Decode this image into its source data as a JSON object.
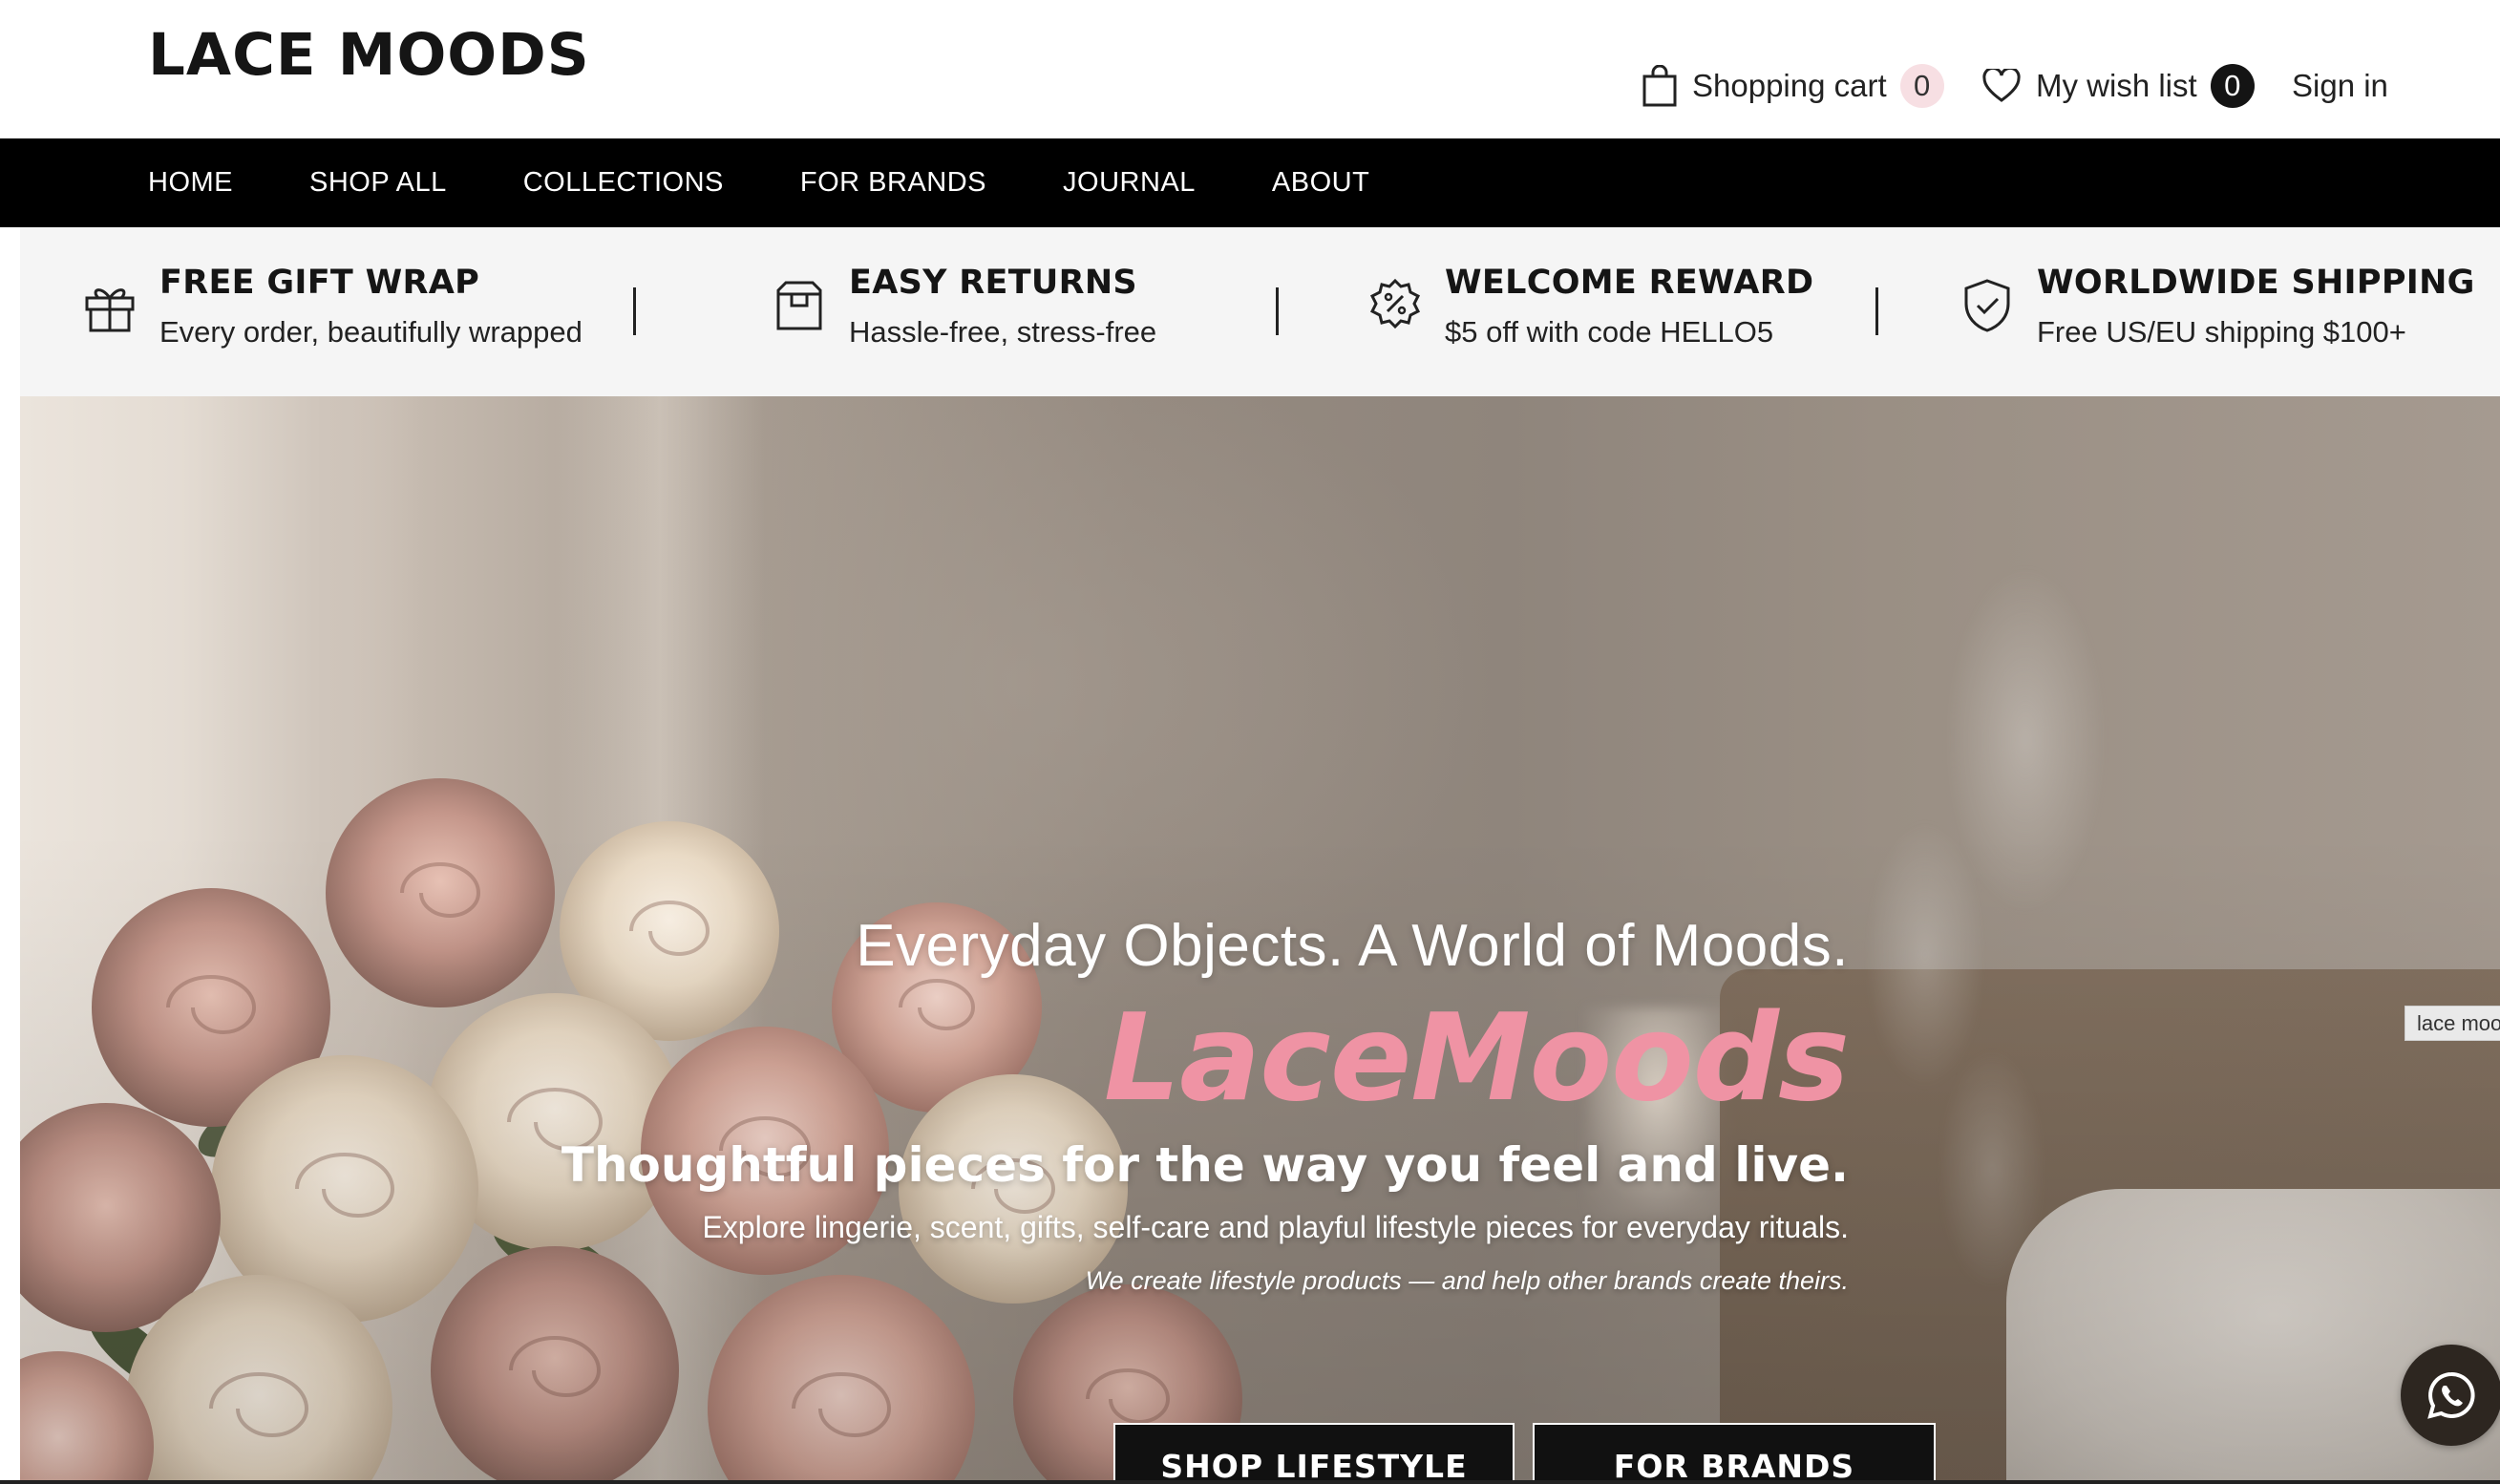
{
  "header": {
    "logo": "LACE MOODS",
    "cart_label": "Shopping cart",
    "cart_count": "0",
    "wishlist_label": "My wish list",
    "wishlist_count": "0",
    "signin_label": "Sign in",
    "cart_icon": "shopping-bag-icon",
    "wishlist_icon": "heart-icon"
  },
  "nav": {
    "items": [
      "HOME",
      "SHOP ALL",
      "COLLECTIONS",
      "FOR BRANDS",
      "JOURNAL",
      "ABOUT"
    ]
  },
  "perks": [
    {
      "icon": "gift-icon",
      "title": "FREE GIFT WRAP",
      "subtitle": "Every order, beautifully wrapped"
    },
    {
      "icon": "box-icon",
      "title": "EASY RETURNS",
      "subtitle": "Hassle-free, stress-free"
    },
    {
      "icon": "discount-badge-icon",
      "title": "WELCOME REWARD",
      "subtitle": "$5 off with code HELLO5"
    },
    {
      "icon": "shield-check-icon",
      "title": "WORLDWIDE SHIPPING",
      "subtitle": "Free US/EU shipping $100+"
    }
  ],
  "hero": {
    "tagline": "Everyday Objects. A World of Moods.",
    "brand": "LaceMoods",
    "headline": "Thoughtful pieces for the way you feel and live.",
    "description": "Explore lingerie, scent, gifts, self-care and playful lifestyle pieces for everyday rituals.",
    "note": "We create lifestyle products — and help other brands create theirs.",
    "btn_lifestyle": "SHOP LIFESTYLE",
    "btn_brands": "FOR BRANDS"
  },
  "side_tab": "lace moods",
  "chat_icon": "whatsapp-icon",
  "colors": {
    "brand_pink": "#ef93a4",
    "nav_bg": "#000000",
    "cart_badge": "#f7dfe3",
    "wish_badge": "#141414"
  }
}
